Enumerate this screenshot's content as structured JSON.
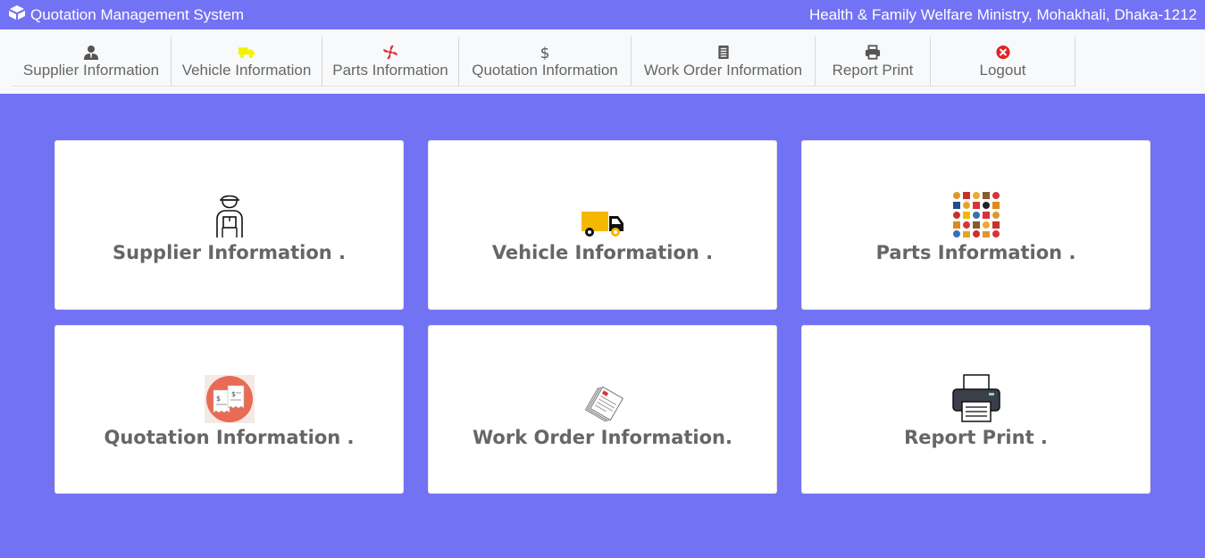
{
  "app": {
    "title": "Quotation Management System",
    "organization": "Health & Family Welfare Ministry, Mohakhali, Dhaka-1212"
  },
  "nav": {
    "items": [
      {
        "label": "Supplier Information",
        "icon": "user-icon",
        "icon_color": "#555555"
      },
      {
        "label": "Vehicle Information",
        "icon": "truck-icon",
        "icon_color": "#f5f200"
      },
      {
        "label": "Parts Information",
        "icon": "fan-icon",
        "icon_color": "#d9323a"
      },
      {
        "label": "Quotation Information",
        "icon": "dollar-icon",
        "icon_color": "#555555"
      },
      {
        "label": "Work Order Information",
        "icon": "document-icon",
        "icon_color": "#555555"
      },
      {
        "label": "Report Print",
        "icon": "printer-icon",
        "icon_color": "#555555"
      },
      {
        "label": "Logout",
        "icon": "close-circle-icon",
        "icon_color": "#e02424"
      }
    ]
  },
  "cards": [
    {
      "label": "Supplier Information .",
      "icon": "delivery-man-icon"
    },
    {
      "label": "Vehicle Information .",
      "icon": "truck-icon"
    },
    {
      "label": "Parts Information .",
      "icon": "parts-grid-icon"
    },
    {
      "label": "Quotation Information .",
      "icon": "invoice-icon"
    },
    {
      "label": "Work Order Information.",
      "icon": "papers-icon"
    },
    {
      "label": "Report Print .",
      "icon": "printer-icon"
    }
  ],
  "colors": {
    "background": "#7272f4",
    "navbar": "#f8f9fa",
    "card": "#ffffff",
    "card_text": "#666666"
  }
}
